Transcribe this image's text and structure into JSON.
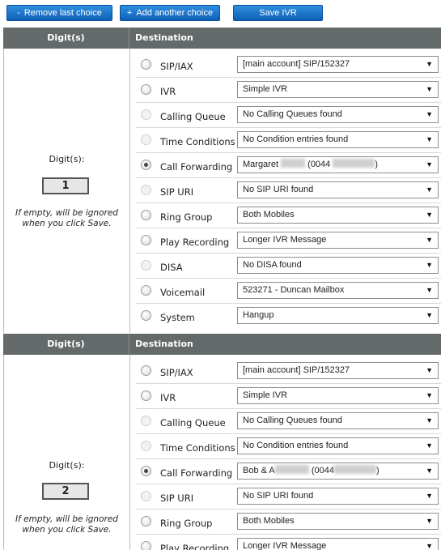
{
  "toolbar": {
    "remove_prefix": "-",
    "remove_label": "Remove last choice",
    "add_prefix": "+",
    "add_label": "Add another choice",
    "save_label": "Save IVR"
  },
  "header": {
    "digits_col": "Digit(s)",
    "destination_col": "Destination"
  },
  "choice_1": {
    "digits_label": "Digit(s):",
    "digit_value": "1",
    "hint_line1": "If empty, will be ignored",
    "hint_line2": "when you click Save.",
    "options": [
      {
        "label": "SIP/IAX",
        "value": "[main account] SIP/152327",
        "state": "enabled"
      },
      {
        "label": "IVR",
        "value": "Simple IVR",
        "state": "enabled"
      },
      {
        "label": "Calling Queue",
        "value": "No Calling Queues found",
        "state": "disabled"
      },
      {
        "label": "Time Conditions",
        "value": "No Condition entries found",
        "state": "disabled"
      },
      {
        "label": "Call Forwarding",
        "value_prefix": "Margaret",
        "value_mid": "(0044",
        "value_suffix": ")",
        "state": "checked"
      },
      {
        "label": "SIP URI",
        "value": "No SIP URI found",
        "state": "disabled"
      },
      {
        "label": "Ring Group",
        "value": "Both Mobiles",
        "state": "enabled"
      },
      {
        "label": "Play Recording",
        "value": "Longer IVR Message",
        "state": "enabled"
      },
      {
        "label": "DISA",
        "value": "No DISA found",
        "state": "disabled"
      },
      {
        "label": "Voicemail",
        "value": "523271 - Duncan Mailbox",
        "state": "enabled"
      },
      {
        "label": "System",
        "value": "Hangup",
        "state": "enabled"
      }
    ]
  },
  "choice_2": {
    "digits_label": "Digit(s):",
    "digit_value": "2",
    "hint_line1": "If empty, will be ignored",
    "hint_line2": "when you click Save.",
    "options": [
      {
        "label": "SIP/IAX",
        "value": "[main account] SIP/152327",
        "state": "enabled"
      },
      {
        "label": "IVR",
        "value": "Simple IVR",
        "state": "enabled"
      },
      {
        "label": "Calling Queue",
        "value": "No Calling Queues found",
        "state": "disabled"
      },
      {
        "label": "Time Conditions",
        "value": "No Condition entries found",
        "state": "disabled"
      },
      {
        "label": "Call Forwarding",
        "value_prefix": "Bob & A",
        "value_mid": "(0044",
        "value_suffix": ")",
        "state": "checked"
      },
      {
        "label": "SIP URI",
        "value": "No SIP URI found",
        "state": "disabled"
      },
      {
        "label": "Ring Group",
        "value": "Both Mobiles",
        "state": "enabled"
      },
      {
        "label": "Play Recording",
        "value": "Longer IVR Message",
        "state": "enabled"
      }
    ]
  },
  "icons": {
    "dropdown": "triangle-down-icon",
    "radio": "radio-button-icon"
  },
  "colors": {
    "button_blue": "#1a73c9",
    "header_grey": "#646a6a"
  }
}
